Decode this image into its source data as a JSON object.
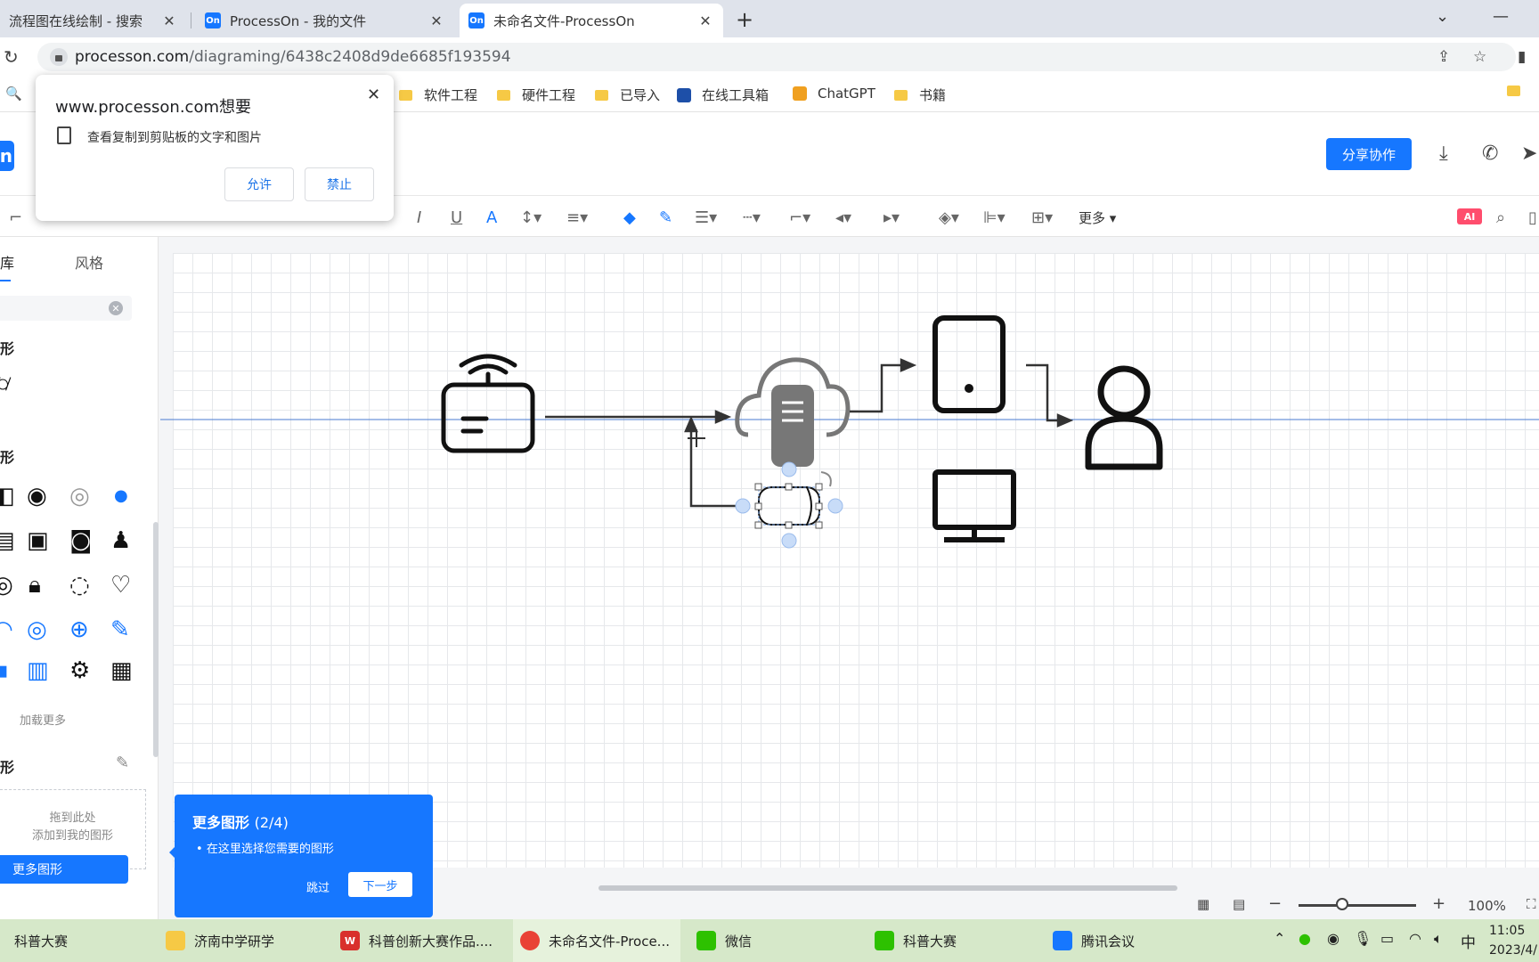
{
  "browser": {
    "tabs": [
      {
        "title": "流程图在线绘制 - 搜索",
        "favicon": ""
      },
      {
        "title": "ProcessOn - 我的文件",
        "favicon": "On"
      },
      {
        "title": "未命名文件-ProcessOn",
        "favicon": "On"
      }
    ],
    "url_host": "processon.com",
    "url_path": "/diagraming/6438c2408d9de6685f193594"
  },
  "bookmarks": [
    "软件工程",
    "硬件工程",
    "已导入",
    "在线工具箱",
    "ChatGPT",
    "书籍"
  ],
  "permission": {
    "title": "www.processon.com想要",
    "text": "查看复制到剪贴板的文字和图片",
    "allow": "允许",
    "block": "禁止"
  },
  "header": {
    "logo": "On",
    "share_label": "分享协作"
  },
  "toolbar": {
    "more_label": "更多",
    "ai_label": "AI"
  },
  "left_panel": {
    "tab_library": "库",
    "tab_style": "风格",
    "section1": "形",
    "section2": "形",
    "section3": "形",
    "load_more": "加载更多",
    "drop_line1": "拖到此处",
    "drop_line2": "添加到我的图形",
    "more_shapes_button": "更多图形"
  },
  "tour": {
    "title": "更多图形",
    "step": "(2/4)",
    "bullet": "在这里选择您需要的图形",
    "skip": "跳过",
    "next": "下一步"
  },
  "status": {
    "zoom": "100%"
  },
  "taskbar": {
    "items": [
      "科普大赛",
      "济南中学研学",
      "科普创新大赛作品....",
      "未命名文件-Proce...",
      "微信",
      "科普大赛",
      "腾讯会议"
    ],
    "ime": "中",
    "time": "11:05",
    "date": "2023/4/"
  },
  "colors": {
    "accent": "#1677ff",
    "taskbar": "#d6e8c9"
  }
}
